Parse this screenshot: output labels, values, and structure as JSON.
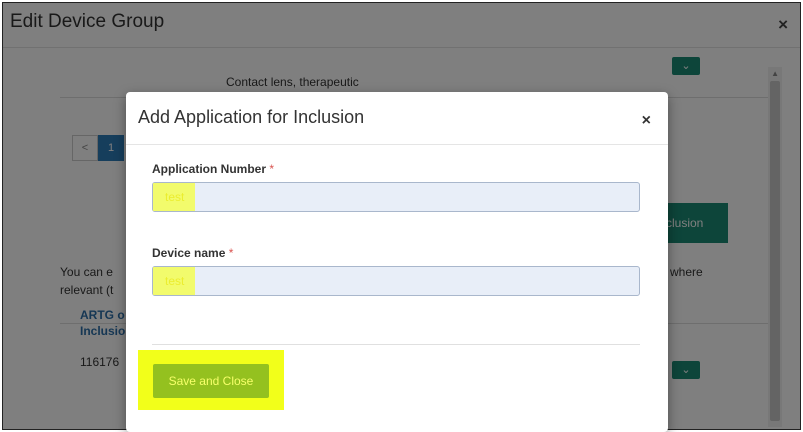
{
  "outer": {
    "title": "Edit Device Group",
    "close": "×"
  },
  "background": {
    "row_text": "Contact lens, therapeutic",
    "pager": {
      "prev": "<",
      "current": "1"
    },
    "chevron": "⌄",
    "inclusion_button": "clusion",
    "note_line1": "You can e",
    "note_line2": "relevant (t",
    "note_where": "where",
    "artg_line1": "ARTG o",
    "artg_line2": "Inclusio",
    "row_number": "116176"
  },
  "modal": {
    "title": "Add Application for Inclusion",
    "close": "×",
    "application_number": {
      "label": "Application Number",
      "required": "*",
      "value": "test"
    },
    "device_name": {
      "label": "Device name",
      "required": "*",
      "value": "test"
    },
    "save_button": "Save and Close"
  },
  "colors": {
    "accent": "#1a8a74",
    "save": "#94c11f",
    "highlight": "#f2ff1a",
    "required": "#d9534f"
  }
}
